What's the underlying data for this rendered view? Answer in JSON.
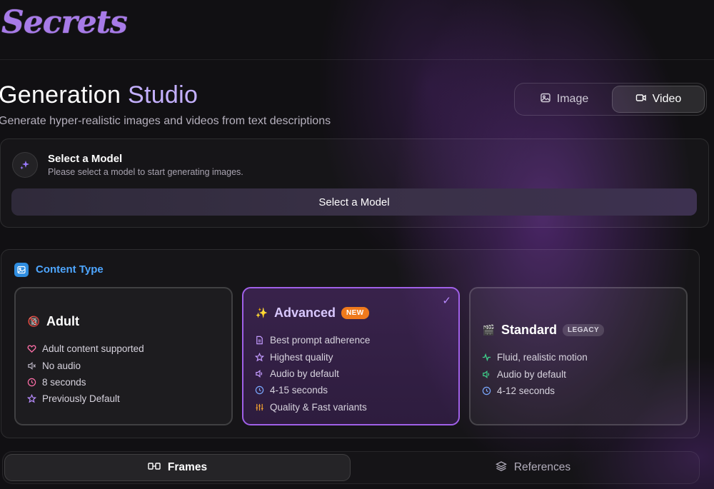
{
  "app": {
    "logo": "Secrets"
  },
  "page": {
    "title_main": "Generation ",
    "title_accent": "Studio",
    "subtitle": "Generate hyper-realistic images and videos from text descriptions"
  },
  "mode_toggle": {
    "image_label": "Image",
    "video_label": "Video",
    "selected": "Video"
  },
  "model": {
    "heading": "Select a Model",
    "description": "Please select a model to start generating images.",
    "button_label": "Select a Model"
  },
  "content_type": {
    "label": "Content Type",
    "cards": [
      {
        "emoji": "🔞",
        "title": "Adult",
        "badge": "",
        "selected": false,
        "features": [
          "Adult content supported",
          "No audio",
          "8 seconds",
          "Previously Default"
        ]
      },
      {
        "emoji": "✨",
        "title": "Advanced",
        "badge": "NEW",
        "selected": true,
        "features": [
          "Best prompt adherence",
          "Highest quality",
          "Audio by default",
          "4-15 seconds",
          "Quality & Fast variants"
        ]
      },
      {
        "emoji": "🎬",
        "title": "Standard",
        "badge": "LEGACY",
        "selected": false,
        "features": [
          "Fluid, realistic motion",
          "Audio by default",
          "4-12 seconds"
        ]
      }
    ]
  },
  "tabs": {
    "frames_label": "Frames",
    "references_label": "References",
    "selected": "Frames"
  },
  "colors": {
    "accent": "#c4b0ff",
    "logo": "#a77ae8",
    "content_type": "#4ea6ff",
    "selected_border": "#a060e8",
    "new_badge": "#f07a1c"
  }
}
